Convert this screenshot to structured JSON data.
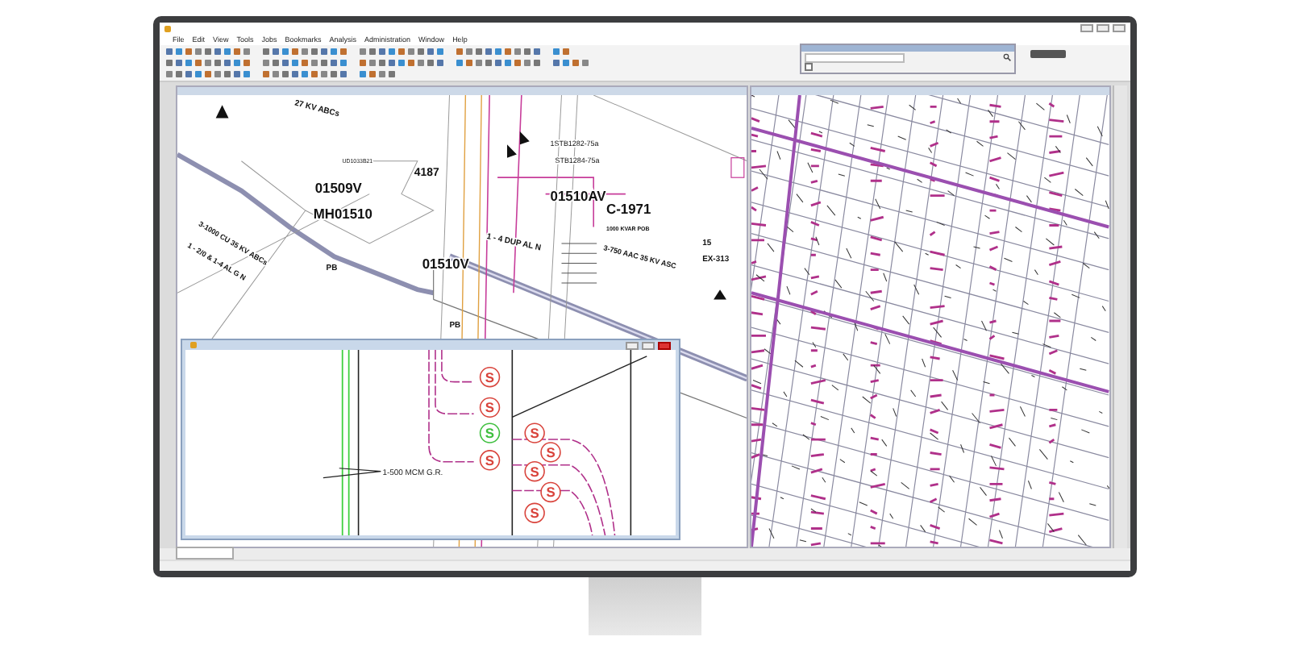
{
  "menu": [
    {
      "label": "File"
    },
    {
      "label": "Edit"
    },
    {
      "label": "View"
    },
    {
      "label": "Tools"
    },
    {
      "label": "Jobs"
    },
    {
      "label": "Bookmarks"
    },
    {
      "label": "Analysis"
    },
    {
      "label": "Administration"
    },
    {
      "label": "Window"
    },
    {
      "label": "Help"
    }
  ],
  "map_labels": [
    "27 KV ABCs",
    "1STB1282-75a",
    "STB1284-75a",
    "UD1033B21",
    "4187",
    "01509V",
    "01510AV",
    "C-1971",
    "1000 KVAR POB",
    "MH01510",
    "3-750 AAC 35 KV ASC",
    "1 - 4 DUP AL N",
    "3-1000 CU 35 KV ABCs",
    "1 - 2/0 & 1-4 AL G N",
    "PB",
    "01510V",
    "PB",
    "15",
    "EX-313"
  ],
  "search_panel": {
    "checkbox": {
      "checked": false
    }
  },
  "detail_window": {
    "label": "1-500 MCM G.R.",
    "symbols": [
      {
        "text": "S",
        "color": "#d9443c"
      },
      {
        "text": "S",
        "color": "#d9443c"
      },
      {
        "text": "S",
        "color": "#3fbf3f"
      },
      {
        "text": "S",
        "color": "#d9443c"
      },
      {
        "text": "S",
        "color": "#d9443c"
      },
      {
        "text": "S",
        "color": "#d9443c"
      },
      {
        "text": "S",
        "color": "#d9443c"
      },
      {
        "text": "S",
        "color": "#d9443c"
      },
      {
        "text": "S",
        "color": "#d9443c"
      }
    ]
  }
}
